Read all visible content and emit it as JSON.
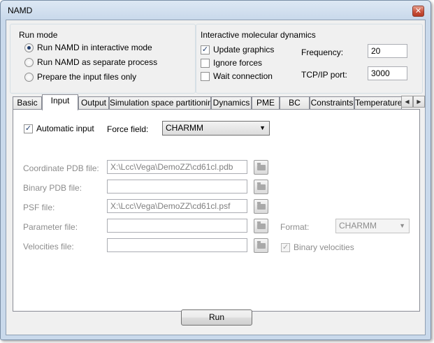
{
  "window": {
    "title": "NAMD",
    "close_glyph": "✕"
  },
  "run_mode": {
    "caption": "Run mode",
    "options": [
      {
        "label": "Run NAMD in interactive mode",
        "checked": true
      },
      {
        "label": "Run NAMD as separate process",
        "checked": false
      },
      {
        "label": "Prepare the input files only",
        "checked": false
      }
    ]
  },
  "imd": {
    "caption": "Interactive molecular dynamics",
    "update_graphics": {
      "label": "Update graphics",
      "checked": true
    },
    "ignore_forces": {
      "label": "Ignore forces",
      "checked": false
    },
    "wait_connection": {
      "label": "Wait connection",
      "checked": false
    },
    "frequency": {
      "label": "Frequency:",
      "value": "20"
    },
    "port": {
      "label": "TCP/IP port:",
      "value": "3000"
    }
  },
  "tabs": [
    {
      "label": "Basic"
    },
    {
      "label": "Input",
      "active": true
    },
    {
      "label": "Output"
    },
    {
      "label": "Simulation space partitioning"
    },
    {
      "label": "Dynamics"
    },
    {
      "label": "PME"
    },
    {
      "label": "BC"
    },
    {
      "label": "Constraints"
    },
    {
      "label": "Temperature"
    }
  ],
  "input_tab": {
    "automatic_input": {
      "label": "Automatic input",
      "checked": true
    },
    "force_field": {
      "label": "Force field:",
      "value": "CHARMM"
    },
    "coordinate_pdb": {
      "label": "Coordinate PDB file:",
      "value": "X:\\Lcc\\Vega\\DemoZZ\\cd61cl.pdb"
    },
    "binary_pdb": {
      "label": "Binary PDB file:",
      "value": ""
    },
    "psf": {
      "label": "PSF file:",
      "value": "X:\\Lcc\\Vega\\DemoZZ\\cd61cl.psf"
    },
    "parameter": {
      "label": "Parameter file:",
      "value": ""
    },
    "velocities": {
      "label": "Velocities file:",
      "value": ""
    },
    "format": {
      "label": "Format:",
      "value": "CHARMM"
    },
    "binary_velocities": {
      "label": "Binary velocities",
      "checked": true
    }
  },
  "footer": {
    "run_label": "Run"
  },
  "icons": {
    "close": "close-icon",
    "browse": "folder-open-icon",
    "scroll_left": "chevron-left-icon",
    "scroll_right": "chevron-right-icon",
    "dropdown": "chevron-down-icon"
  }
}
